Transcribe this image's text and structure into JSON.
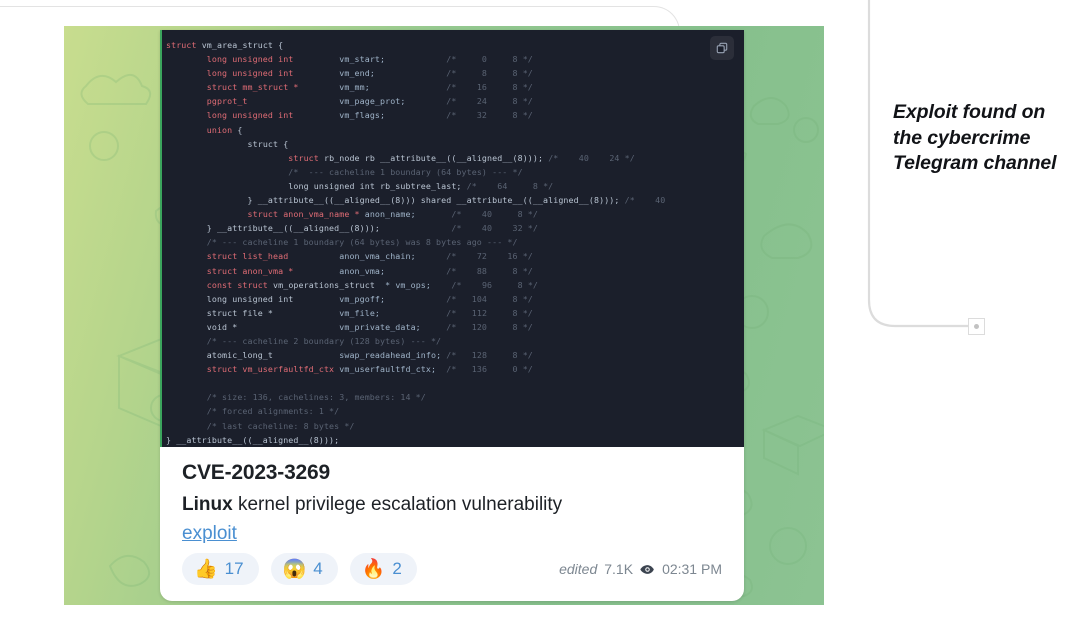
{
  "annotation": {
    "text": "Exploit found on the cybercrime Telegram channel"
  },
  "message": {
    "code_block": {
      "copy_icon": "copy-icon",
      "language": "c",
      "lines": [
        "struct vm_area_struct {",
        "        long unsigned int         vm_start;            /*     0     8 */",
        "        long unsigned int         vm_end;              /*     8     8 */",
        "        struct mm_struct *        vm_mm;               /*    16     8 */",
        "        pgprot_t                  vm_page_prot;        /*    24     8 */",
        "        long unsigned int         vm_flags;            /*    32     8 */",
        "        union {",
        "                struct {",
        "                        struct rb_node rb __attribute__((__aligned__(8))); /*    40    24 */",
        "                        /*  --- cacheline 1 boundary (64 bytes) --- */",
        "                        long unsigned int rb_subtree_last; /*    64     8 */",
        "                } __attribute__((__aligned__(8))) shared __attribute__((__aligned__(8))); /*    40",
        "                struct anon_vma_name * anon_name;       /*    40     8 */",
        "        } __attribute__((__aligned__(8)));              /*    40    32 */",
        "        /* --- cacheline 1 boundary (64 bytes) was 8 bytes ago --- */",
        "        struct list_head          anon_vma_chain;      /*    72    16 */",
        "        struct anon_vma *         anon_vma;            /*    88     8 */",
        "        const struct vm_operations_struct  * vm_ops;    /*    96     8 */",
        "        long unsigned int         vm_pgoff;            /*   104     8 */",
        "        struct file *             vm_file;             /*   112     8 */",
        "        void *                    vm_private_data;     /*   120     8 */",
        "        /* --- cacheline 2 boundary (128 bytes) --- */",
        "        atomic_long_t             swap_readahead_info; /*   128     8 */",
        "        struct vm_userfaultfd_ctx vm_userfaultfd_ctx;  /*   136     0 */",
        "",
        "        /* size: 136, cachelines: 3, members: 14 */",
        "        /* forced alignments: 1 */",
        "        /* last cacheline: 8 bytes */",
        "} __attribute__((__aligned__(8)));"
      ]
    },
    "caption": {
      "title": "CVE-2023-3269",
      "body_bold": "Linux",
      "body_rest": " kernel privilege escalation vulnerability",
      "link": "exploit"
    },
    "reactions": [
      {
        "emoji": "👍",
        "name": "thumbs-up",
        "count": "17"
      },
      {
        "emoji": "😱",
        "name": "scream",
        "count": "4"
      },
      {
        "emoji": "🔥",
        "name": "fire",
        "count": "2"
      }
    ],
    "meta": {
      "edited": "edited",
      "views": "7.1K",
      "views_icon": "eye-icon",
      "time": "02:31 PM"
    }
  },
  "colors": {
    "chat_green": "#8fc58f",
    "code_bg": "#1b1f2b",
    "link_blue": "#4a8fd1",
    "accent_green": "#3ba55d"
  }
}
